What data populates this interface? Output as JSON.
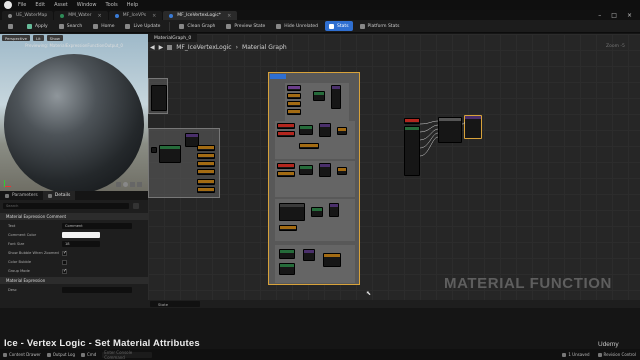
{
  "menu": [
    "File",
    "Edit",
    "Asset",
    "Window",
    "Tools",
    "Help"
  ],
  "tabs": [
    {
      "label": "UE_WaterMap",
      "active": false
    },
    {
      "label": "MM_Water",
      "active": false
    },
    {
      "label": "MF_IceVPs",
      "active": false
    },
    {
      "label": "MF_IceVertexLogic*",
      "active": true
    }
  ],
  "toolbar": {
    "save": "Save",
    "apply": "Apply",
    "search": "Search",
    "home": "Home",
    "live_update": "Live Update",
    "clean_graph": "Clean Graph",
    "preview_state": "Preview State",
    "hide_unrelated": "Hide Unrelated",
    "stats": "Stats",
    "platform_stats": "Platform Stats"
  },
  "viewport": {
    "perspective": "Perspective",
    "lit": "Lit",
    "show": "Show",
    "preview_label": "Previewing: MaterialExpressionFunctionOutput_0"
  },
  "params": {
    "tab_parameters": "Parameters",
    "tab_details": "Details",
    "search_placeholder": "Search",
    "section_comment": "Material Expression Comment",
    "rows": [
      {
        "label": "Text",
        "value": "Comment"
      },
      {
        "label": "Comment Color",
        "value": ""
      },
      {
        "label": "Font Size",
        "value": "18"
      }
    ],
    "checks": [
      {
        "label": "Show Bubble When Zoomed",
        "checked": true
      },
      {
        "label": "Color Bubble",
        "checked": false
      },
      {
        "label": "Group Mode",
        "checked": true
      }
    ],
    "section_expression": "Material Expression",
    "desc_label": "Desc"
  },
  "graph": {
    "tab": "MaterialGraph_0",
    "breadcrumb_root": "MF_IceVertexLogic",
    "breadcrumb_leaf": "Material Graph",
    "zoom": "Zoom -5",
    "watermark": "MATERIAL FUNCTION",
    "state": "State"
  },
  "caption": "Ice - Vertex Logic - Set Material Attributes",
  "brand": "Udemy",
  "status": {
    "content_drawer": "Content Drawer",
    "output_log": "Output Log",
    "cmd": "Cmd",
    "cmd_placeholder": "Enter Console Command",
    "unsaved": "1 Unsaved",
    "revision": "Revision Control"
  },
  "colors": {
    "accent": "#2f6fd1",
    "comment_border": "#d8a23a",
    "node_header_red": "#b3261e",
    "pin_green": "#8bd24a"
  }
}
